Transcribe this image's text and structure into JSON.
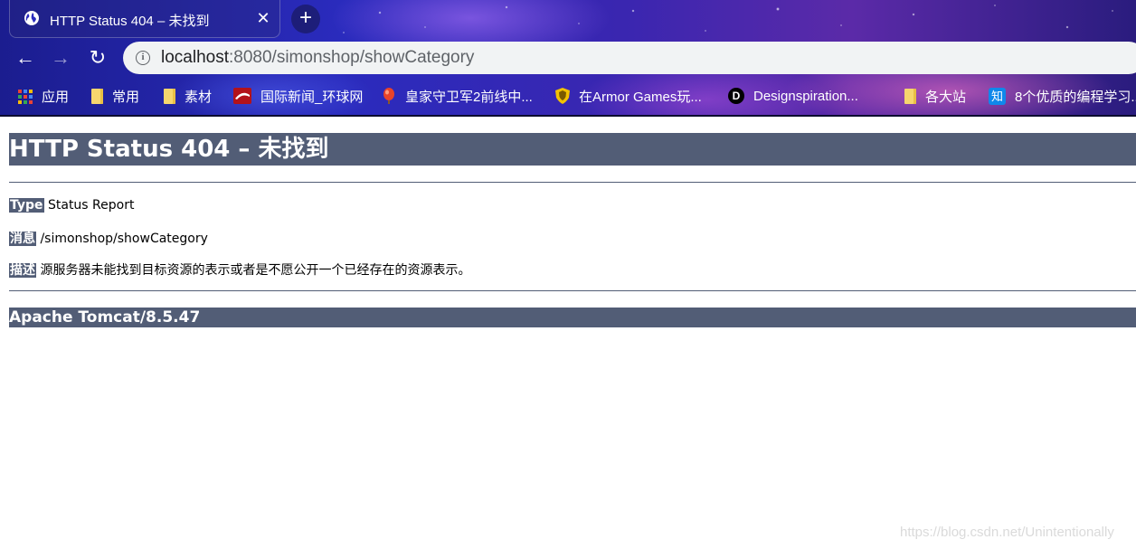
{
  "tab": {
    "title": "HTTP Status 404 – 未找到",
    "close_glyph": "✕"
  },
  "new_tab_glyph": "+",
  "nav": {
    "back_glyph": "←",
    "forward_glyph": "→",
    "reload_glyph": "↻"
  },
  "omnibox": {
    "info_glyph": "i",
    "url_host": "localhost",
    "url_rest": ":8080/simonshop/showCategory"
  },
  "bookmarks": [
    {
      "label": "应用",
      "icon": "apps-grid-icon"
    },
    {
      "label": "常用",
      "icon": "folder-icon"
    },
    {
      "label": "素材",
      "icon": "folder-icon"
    },
    {
      "label": "国际新闻_环球网",
      "icon": "huanqiu-icon"
    },
    {
      "label": "皇家守卫军2前线中...",
      "icon": "balloon-icon"
    },
    {
      "label": "在Armor Games玩...",
      "icon": "armor-games-shield-icon"
    },
    {
      "label": "Designspiration...",
      "icon": "designspiration-d-icon",
      "glyph": "D"
    },
    {
      "label": "各大站",
      "icon": "folder-icon"
    },
    {
      "label": "8个优质的编程学习...",
      "icon": "zhihu-icon",
      "glyph": "知"
    }
  ],
  "page": {
    "heading": "HTTP Status 404 – 未找到",
    "type_label": "Type",
    "type_value": "Status Report",
    "message_label": "消息",
    "message_value": "/simonshop/showCategory",
    "description_label": "描述",
    "description_value": "源服务器未能找到目标资源的表示或者是不愿公开一个已经存在的资源表示。",
    "footer": "Apache Tomcat/8.5.47"
  },
  "watermark": "https://blog.csdn.net/Unintentionally",
  "colors": {
    "tomcat_band": "#525d76",
    "omnibox_bg": "#f1f3f4"
  }
}
